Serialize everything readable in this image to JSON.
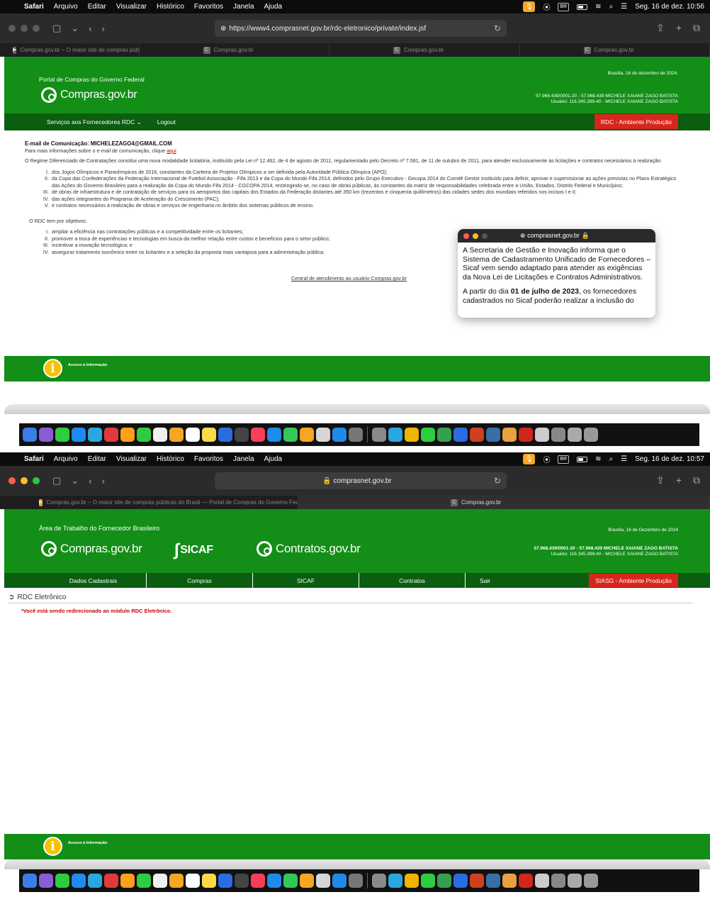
{
  "screens": [
    {
      "menubar": {
        "app": "Safari",
        "menus": [
          "Arquivo",
          "Editar",
          "Visualizar",
          "Histórico",
          "Favoritos",
          "Janela",
          "Ajuda"
        ],
        "keyboard": "BR",
        "clock": "Seg. 16 de dez.  10:56"
      },
      "url": "https://www4.comprasnet.gov.br/rdc-eletronico/private/index.jsf",
      "tabs": [
        {
          "label": "Compras.gov.br – O maior site de compras públicas do...",
          "active": false
        },
        {
          "label": "Compras.gov.br",
          "active": false
        },
        {
          "label": "Compras.gov.br",
          "active": false
        },
        {
          "label": "Compras.gov.br",
          "active": false
        }
      ],
      "header": {
        "portal_label": "Portal de Compras do Governo Federal",
        "logo": "Compras.gov.br",
        "date": "Brasília, 16 de dezembro de 2024.",
        "cnpj": "57.968.439/0001-20 - 57.968.439 MICHELE XAIANE ZAGO BATISTA",
        "user": "Usuário: 116.345.399-40 - MICHELE XAIANE ZAGO BATISTA"
      },
      "nav": {
        "services": "Serviços aos Fornecedores RDC",
        "logout": "Logout",
        "env": "RDC - Ambiente Produção"
      },
      "content": {
        "email_label": "E-mail de Comunicação: MICHELEZAGO4@GMAIL.COM",
        "email_info": "Para mais informações sobre o e-mail de comunicação, clique",
        "email_link": "aqui",
        "intro": "O Regime Diferenciado de Contratações constitui uma nova modalidade licitatória, instituído pela Lei nº 12.462, de 4 de agosto de 2011, regulamentado pelo Decreto nº 7.581, de 11 de outubro de 2011, para atender exclusivamente às licitações e contratos necessários à realização:",
        "items": [
          {
            "num": "I.",
            "text": "dos Jogos Olímpicos e Paraolímpicos de 2016, constantes da Carteira de Projetos Olímpicos a ser definida pela Autoridade Pública Olímpica (APO);"
          },
          {
            "num": "II.",
            "text": "da Copa das Confederações da Federação Internacional de Futebol Associação - Fifa 2013 e da Copa do Mundo Fifa 2014, definidos pelo Grupo Executivo - Gecopa 2014 do Comitê Gestor instituído para definir, aprovar e supervisionar as ações previstas no Plano Estratégico das Ações do Governo Brasileiro para a realização da Copa do Mundo Fifa 2014 - CGCOPA 2014, restringindo-se, no caso de obras públicas, às constantes da matriz de responsabilidades celebrada entre a União, Estados, Distrito Federal e Municípios;"
          },
          {
            "num": "III.",
            "text": "de obras de infraestrutura e de contratação de serviços para os aeroportos das capitais dos Estados da Federação distantes até 350 km (trezentos e cinquenta quilômetros) das cidades sedes dos mundiais referidos nos incisos I e II;"
          },
          {
            "num": "IV.",
            "text": "das ações integrantes do Programa de Aceleração do Crescimento (PAC);"
          },
          {
            "num": "V.",
            "text": "e contratos necessários à realização de obras e serviços de engenharia no âmbito dos sistemas públicos de ensino."
          }
        ],
        "objectives_title": "O RDC tem por objetivos:",
        "objectives": [
          {
            "num": "I.",
            "text": "ampliar a eficiência nas contratações públicas e a competitividade entre os licitantes;"
          },
          {
            "num": "II.",
            "text": "promover a troca de experiências e tecnologias em busca da melhor relação entre custos e benefícios para o setor público;"
          },
          {
            "num": "III.",
            "text": "incentivar a inovação tecnológica; e"
          },
          {
            "num": "IV.",
            "text": "assegurar tratamento isonômico entre os licitantes e a seleção da proposta mais vantajosa para a administração pública."
          }
        ],
        "central": "Central de atendimento ao usuário Compras.gov.br"
      },
      "popup": {
        "title": "comprasnet.gov.br",
        "p1": "A Secretaria de Gestão e Inovação informa que o Sistema de Cadastramento Unificado de Fornecedores – Sicaf vem sendo adaptado para atender as exigências da Nova Lei de Licitações e Contratos Administrativos.",
        "p2_pre": "A partir do dia ",
        "p2_bold": "01 de julho de 2023",
        "p2_post": ", os fornecedores cadastrados no Sicaf poderão realizar a inclusão do"
      },
      "footer": {
        "info": "Acesso à Informação"
      }
    },
    {
      "menubar": {
        "app": "Safari",
        "menus": [
          "Arquivo",
          "Editar",
          "Visualizar",
          "Histórico",
          "Favoritos",
          "Janela",
          "Ajuda"
        ],
        "keyboard": "BR",
        "clock": "Seg. 16 de dez.  10:57"
      },
      "url": "comprasnet.gov.br",
      "tabs": [
        {
          "label": "Compras.gov.br – O maior site de compras públicas do Brasil — Portal de Compras do Governo Federal",
          "active": false
        },
        {
          "label": "Compras.gov.br",
          "active": true
        }
      ],
      "header": {
        "area": "Área de Trabalho do Fornecedor Brasileiro",
        "logo1": "Compras.gov.br",
        "logo2": "SICAF",
        "logo3": "Contratos.gov.br",
        "date": "Brasília, 16 de Dezembro de 2024",
        "cnpj": "57.968.439/0001-20 - 57.968.439 MICHELE XAIANE ZAGO BATISTA",
        "user": "Usuário: 116.345.399-40 - MICHELE XAIANE ZAGO BATISTA"
      },
      "nav": {
        "items": [
          "Dados Cadastrais",
          "Compras",
          "SICAF",
          "Contratos",
          "Sair"
        ],
        "env": "SIASG - Ambiente Produção"
      },
      "content": {
        "title": "RDC Eletrônico",
        "message": "*Você está sendo redirecionado ao módulo RDC Eletrônico."
      },
      "footer": {
        "info": "Acesso à Informação"
      }
    }
  ],
  "dock_colors": [
    "#3b7de8",
    "#8a5cd6",
    "#2ecc40",
    "#1d8cf0",
    "#2aa7e0",
    "#e03b3b",
    "#ff9f1c",
    "#2ecc40",
    "#f0f0f0",
    "#f5a623",
    "#ffffff",
    "#ffd84a",
    "#2b6de0",
    "#444444",
    "#fa3e5a",
    "#1f8ae8",
    "#34c759",
    "#f5a623",
    "#d6d6d6",
    "#1f8ae8",
    "#777777",
    "#8a8a8a",
    "#2aa7e0",
    "#f0b400",
    "#2ecc40",
    "#35a050",
    "#2b6de0",
    "#d04020",
    "#3a6ea5",
    "#e8a040",
    "#d0261b",
    "#cccccc",
    "#888888",
    "#aaaaaa",
    "#999999"
  ]
}
